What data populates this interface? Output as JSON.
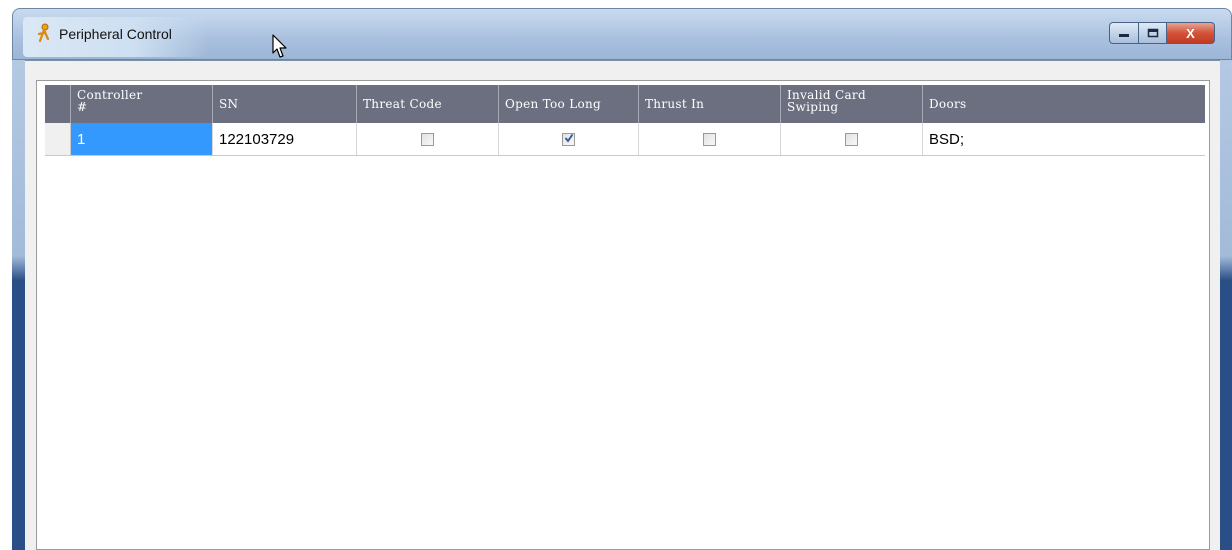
{
  "window": {
    "title": "Peripheral Control",
    "buttons": {
      "minimize": "‒",
      "maximize": "□",
      "close": "X"
    }
  },
  "grid": {
    "columns": [
      {
        "label": "Controller\n#"
      },
      {
        "label": "SN"
      },
      {
        "label": "Threat Code"
      },
      {
        "label": "Open Too Long"
      },
      {
        "label": "Thrust In"
      },
      {
        "label": "Invalid Card\nSwiping"
      },
      {
        "label": "Doors"
      }
    ],
    "rows": [
      {
        "controller": "1",
        "sn": "122103729",
        "threat_code": false,
        "open_too_long": true,
        "thrust_in": false,
        "invalid_card_swiping": false,
        "doors": "BSD;"
      }
    ]
  },
  "colors": {
    "header_bg": "#6b6f7f",
    "selected_cell": "#3399ff",
    "frame_dark": "#2a4f86"
  },
  "icons": {
    "app": "key-person-icon",
    "cursor": "mouse-pointer-icon",
    "check": "checkmark-icon"
  }
}
